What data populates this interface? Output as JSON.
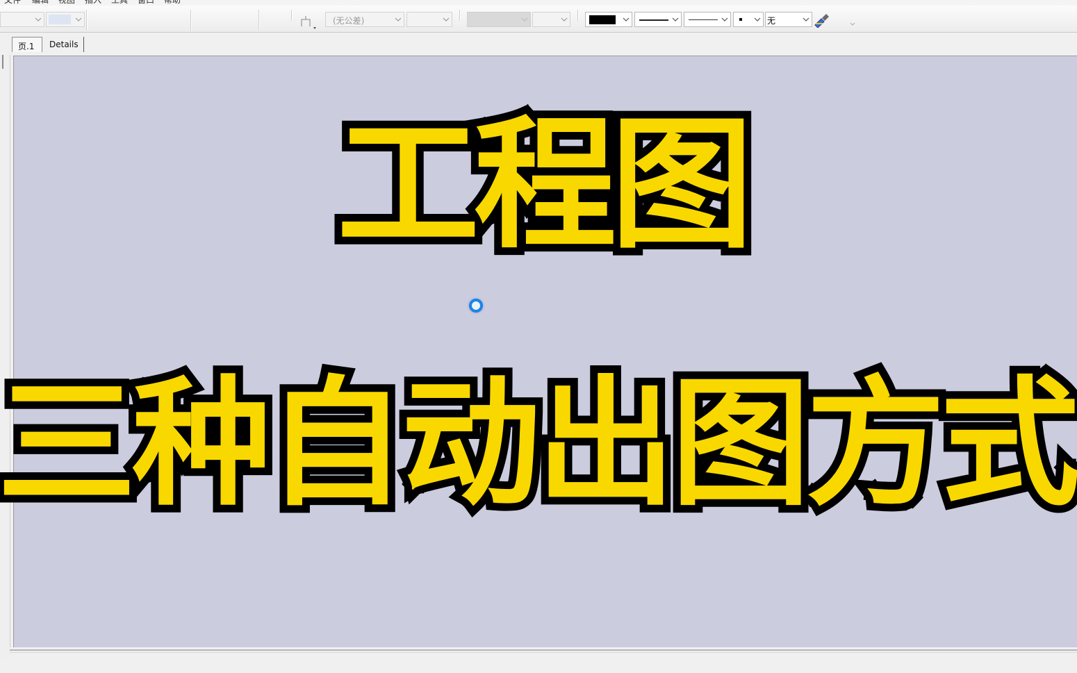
{
  "menubar": {
    "items": [
      "文件",
      "编辑",
      "视图",
      "插入",
      "工具",
      "窗口",
      "帮助"
    ]
  },
  "toolbar": {
    "tolerance_placeholder": "(无公差)",
    "fill_value": "无",
    "line_color": "#000000",
    "brush_icon": "format-painter-icon"
  },
  "tabs": [
    {
      "label": "页.1",
      "active": true
    },
    {
      "label": "Details",
      "active": false
    }
  ],
  "canvas": {
    "background": "#ccccdf"
  },
  "captions": {
    "title": "工程图",
    "subtitle": "三种自动出图方式",
    "fill_color": "#f9d800",
    "stroke_color": "#000000"
  },
  "cursor": {
    "type": "busy-spinner",
    "color": "#1b84e6"
  }
}
